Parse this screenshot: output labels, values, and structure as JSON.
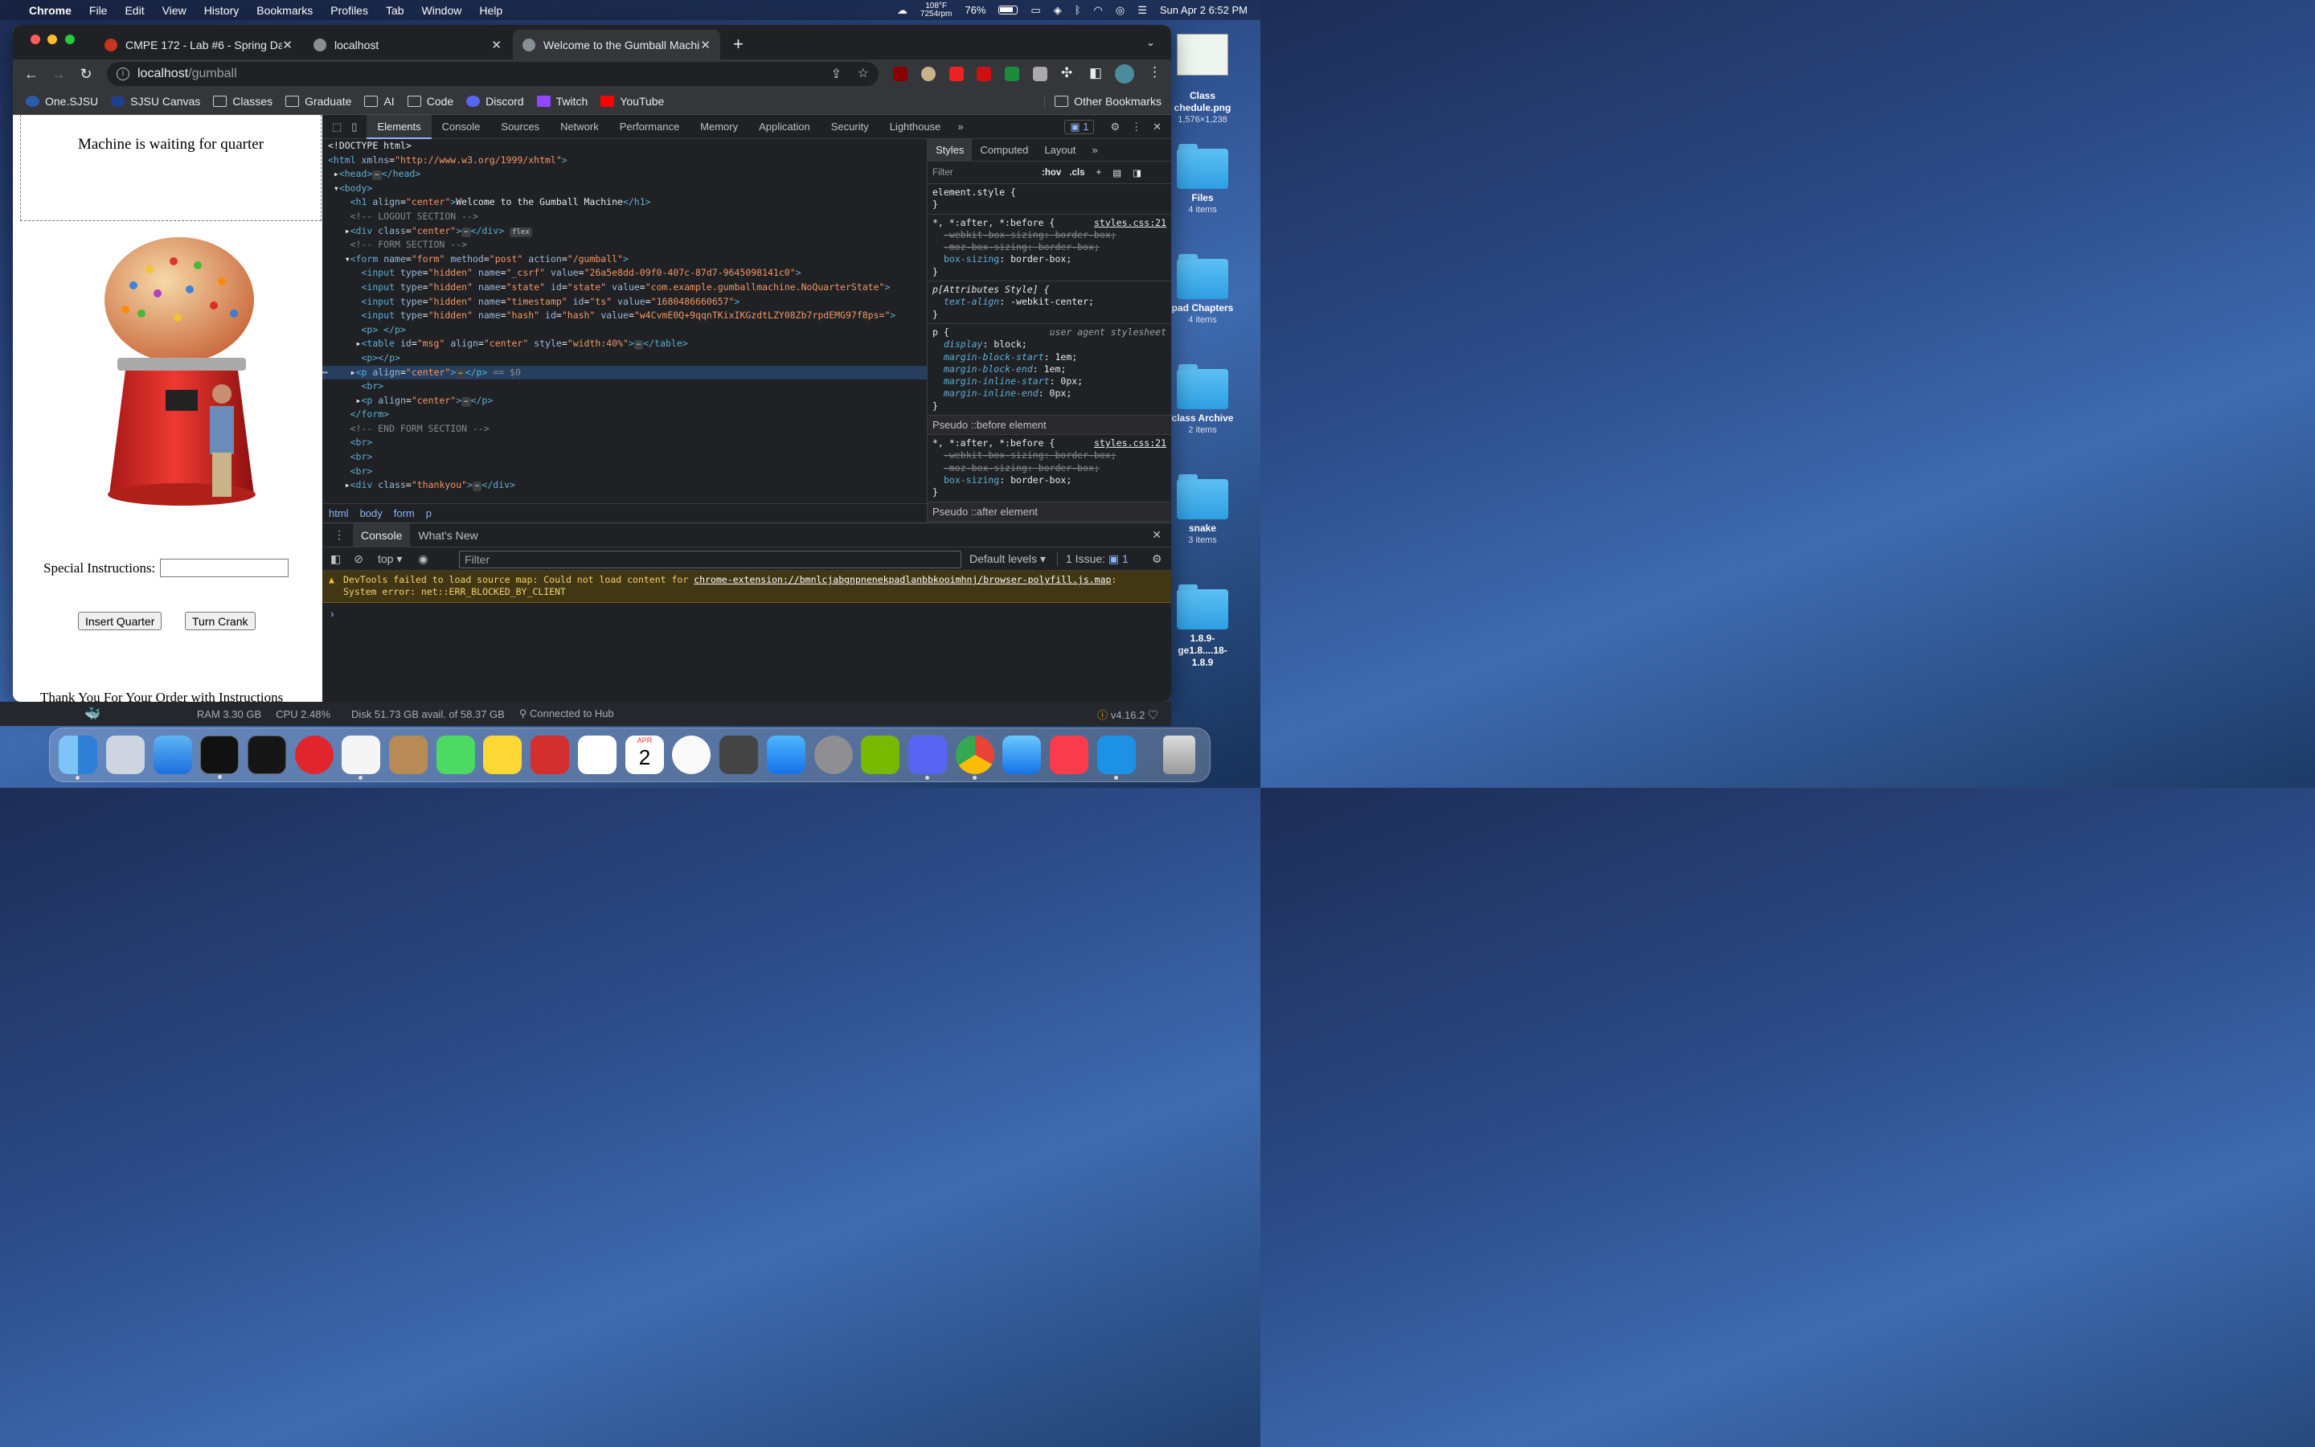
{
  "menubar": {
    "app": "Chrome",
    "items": [
      "File",
      "Edit",
      "View",
      "History",
      "Bookmarks",
      "Profiles",
      "Tab",
      "Window",
      "Help"
    ],
    "temp": "108°F",
    "rpm": "7254rpm",
    "battery": "76%",
    "datetime": "Sun Apr 2  6:52 PM"
  },
  "tabs": [
    {
      "title": "CMPE 172 - Lab #6 - Spring Da"
    },
    {
      "title": "localhost"
    },
    {
      "title": "Welcome to the Gumball Machi"
    }
  ],
  "url": {
    "host": "localhost",
    "path": "/gumball"
  },
  "bookmarks": [
    "One.SJSU",
    "SJSU Canvas",
    "Classes",
    "Graduate",
    "AI",
    "Code",
    "Discord",
    "Twitch",
    "YouTube"
  ],
  "other_bookmarks": "Other Bookmarks",
  "page": {
    "message": "Machine is waiting for quarter",
    "special_label": "Special Instructions:",
    "special_value": "",
    "insert_btn": "Insert Quarter",
    "crank_btn": "Turn Crank",
    "thanks": "Thank You For Your Order with Instructions"
  },
  "devtools": {
    "tabs": [
      "Elements",
      "Console",
      "Sources",
      "Network",
      "Performance",
      "Memory",
      "Application",
      "Security",
      "Lighthouse"
    ],
    "issues_count": "1",
    "breadcrumbs": [
      "html",
      "body",
      "form",
      "p"
    ],
    "styles_tabs": [
      "Styles",
      "Computed",
      "Layout"
    ],
    "styles_filter": "Filter",
    "hov": ":hov",
    "cls": ".cls",
    "pseudo_before": "Pseudo ::before element",
    "pseudo_after": "Pseudo ::after element",
    "drawer_tabs": [
      "Console",
      "What's New"
    ],
    "context": "top",
    "console_filter": "Filter",
    "levels": "Default levels",
    "issues": "1 Issue:",
    "issues_n": "1",
    "warning_line1": "DevTools failed to load source map: Could not load content for ",
    "warning_link": "chrome-extension://bmnlcjabgnpnenekpadlanbbkooimhnj/browser-polyfill.js.map",
    "warning_line2": "System error: net::ERR_BLOCKED_BY_CLIENT"
  },
  "status": {
    "ram": "RAM 3.30 GB",
    "cpu": "CPU 2.48%",
    "disk": "Disk 51.73 GB avail. of 58.37 GB",
    "hub": "Connected to Hub",
    "version": "v4.16.2"
  },
  "desktop": [
    {
      "name": "Class",
      "name2": "chedule.png",
      "sub": "1,576×1,238"
    },
    {
      "name": "Files",
      "sub": "4 items"
    },
    {
      "name": "pad Chapters",
      "sub": "4 items"
    },
    {
      "name": "class Archive",
      "sub": "2 items"
    },
    {
      "name": "snake",
      "sub": "3 items"
    },
    {
      "name": "1.8.9-",
      "name2": "ge1.8....18-1.8.9",
      "sub": ""
    }
  ],
  "dock_date": {
    "month": "APR",
    "day": "2"
  }
}
